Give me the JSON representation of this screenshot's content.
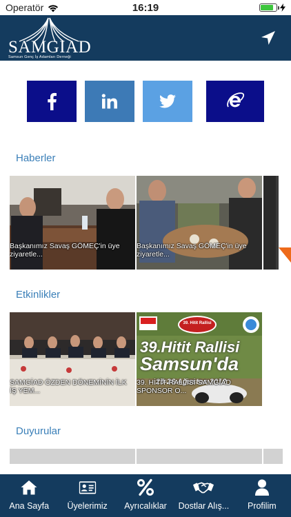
{
  "status_bar": {
    "carrier": "Operatör",
    "time": "16:19",
    "battery_level": 0.8,
    "icons": [
      "wifi-icon",
      "battery-icon",
      "charging-icon"
    ]
  },
  "header": {
    "logo_title": "SAMGIAD",
    "logo_subtitle": "Samsun Genç İş Adamları Derneği",
    "nav_icon": "location-arrow-icon",
    "color": "#143b5e"
  },
  "social": [
    {
      "name": "facebook",
      "icon": "facebook-icon",
      "color": "#0b0e8a"
    },
    {
      "name": "linkedin",
      "icon": "linkedin-icon",
      "color": "#3d7ab6"
    },
    {
      "name": "twitter",
      "icon": "twitter-icon",
      "color": "#5ba1e3"
    },
    {
      "name": "internet explorer",
      "icon": "internet-explorer-icon",
      "color": "#0b0e8a"
    }
  ],
  "sections": {
    "haberler": {
      "title": "Haberler",
      "items": [
        {
          "caption": "Başkanımız Savaş GÖMEÇ'in üye ziyaretle..."
        },
        {
          "caption": "Başkanımız Savaş GÖMEÇ'in üye ziyaretle..."
        }
      ]
    },
    "etkinlikler": {
      "title": "Etkinlikler",
      "items": [
        {
          "caption": "SAMGİAD ÖZDEN DÖNEMİNİN İLK İŞ YEM..."
        },
        {
          "caption": "39. HİTİT RALLİSİ SAMGİAD SPONSOR O...",
          "poster_title": "39. Hitit Rallisi",
          "poster_main": "39.Hitit Rallisi",
          "poster_city": "Samsun'da",
          "poster_date": "25-26 Ağustos 2012"
        }
      ]
    },
    "duyurular": {
      "title": "Duyurular",
      "items": []
    }
  },
  "tabs": [
    {
      "label": "Ana Sayfa",
      "icon": "home-icon"
    },
    {
      "label": "Üyelerimiz",
      "icon": "id-card-icon"
    },
    {
      "label": "Ayrıcalıklar",
      "icon": "percent-icon"
    },
    {
      "label": "Dostlar Alış...",
      "icon": "handshake-icon"
    },
    {
      "label": "Profilim",
      "icon": "user-icon"
    }
  ]
}
